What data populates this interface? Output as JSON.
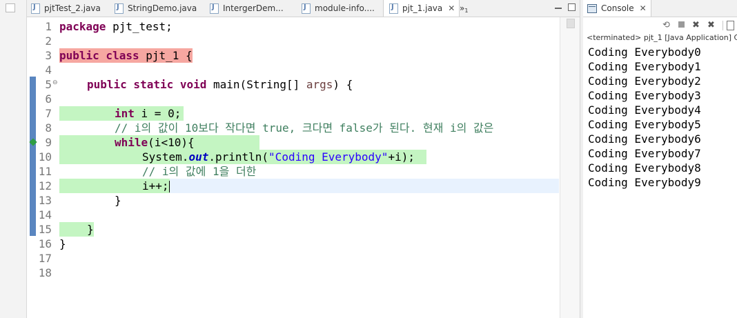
{
  "editor": {
    "tabs": [
      {
        "label": "pjtTest_2.java",
        "active": false
      },
      {
        "label": "StringDemo.java",
        "active": false
      },
      {
        "label": "IntergerDem...",
        "active": false
      },
      {
        "label": "module-info....",
        "active": false
      },
      {
        "label": "pjt_1.java",
        "active": true
      }
    ],
    "active_tab_close": "✕",
    "overflow_label": "»",
    "overflow_count": "1",
    "line_numbers": [
      "1",
      "2",
      "3",
      "4",
      "5",
      "6",
      "7",
      "8",
      "9",
      "10",
      "11",
      "12",
      "13",
      "14",
      "15",
      "16",
      "17",
      "18"
    ],
    "code": {
      "l1": {
        "kw": "package",
        "rest": " pjt_test;"
      },
      "l3": {
        "kw": "public class",
        "rest": " pjt_1 {"
      },
      "l5": {
        "kw": "public static void",
        "rest1": " main(String[] ",
        "param": "args",
        "rest2": ") {"
      },
      "l7": {
        "kw": "int",
        "rest": " i = 0;"
      },
      "l8": {
        "comment": "// i의 값이 10보다 작다면 true, 크다면 false가 된다. 현재 i의 값은"
      },
      "l9": {
        "kw": "while",
        "rest": "(i<10){"
      },
      "l10": {
        "pre": "System.",
        "field": "out",
        "mid": ".println(",
        "str": "\"Coding Everybody\"",
        "post": "+i);"
      },
      "l11": {
        "comment": "// i의 값에 1을 더한"
      },
      "l12": {
        "code": "i++;"
      },
      "l13": {
        "code": "}"
      },
      "l15": {
        "code": "}"
      },
      "l16": {
        "code": "}"
      }
    }
  },
  "console": {
    "tab_label": "Console",
    "tab_close": "✕",
    "status": "<terminated> pjt_1 [Java Application] C:",
    "output": [
      "Coding Everybody0",
      "Coding Everybody1",
      "Coding Everybody2",
      "Coding Everybody3",
      "Coding Everybody4",
      "Coding Everybody5",
      "Coding Everybody6",
      "Coding Everybody7",
      "Coding Everybody8",
      "Coding Everybody9"
    ]
  },
  "colors": {
    "keyword": "#7f0055",
    "comment": "#3f7f5f",
    "string": "#2a00ff",
    "static_field": "#0000c0",
    "added_highlight": "#c4f5c2",
    "changed_highlight": "#f6a7a1",
    "current_line": "#e8f2fe",
    "quick_diff_band": "#5a86c0"
  }
}
